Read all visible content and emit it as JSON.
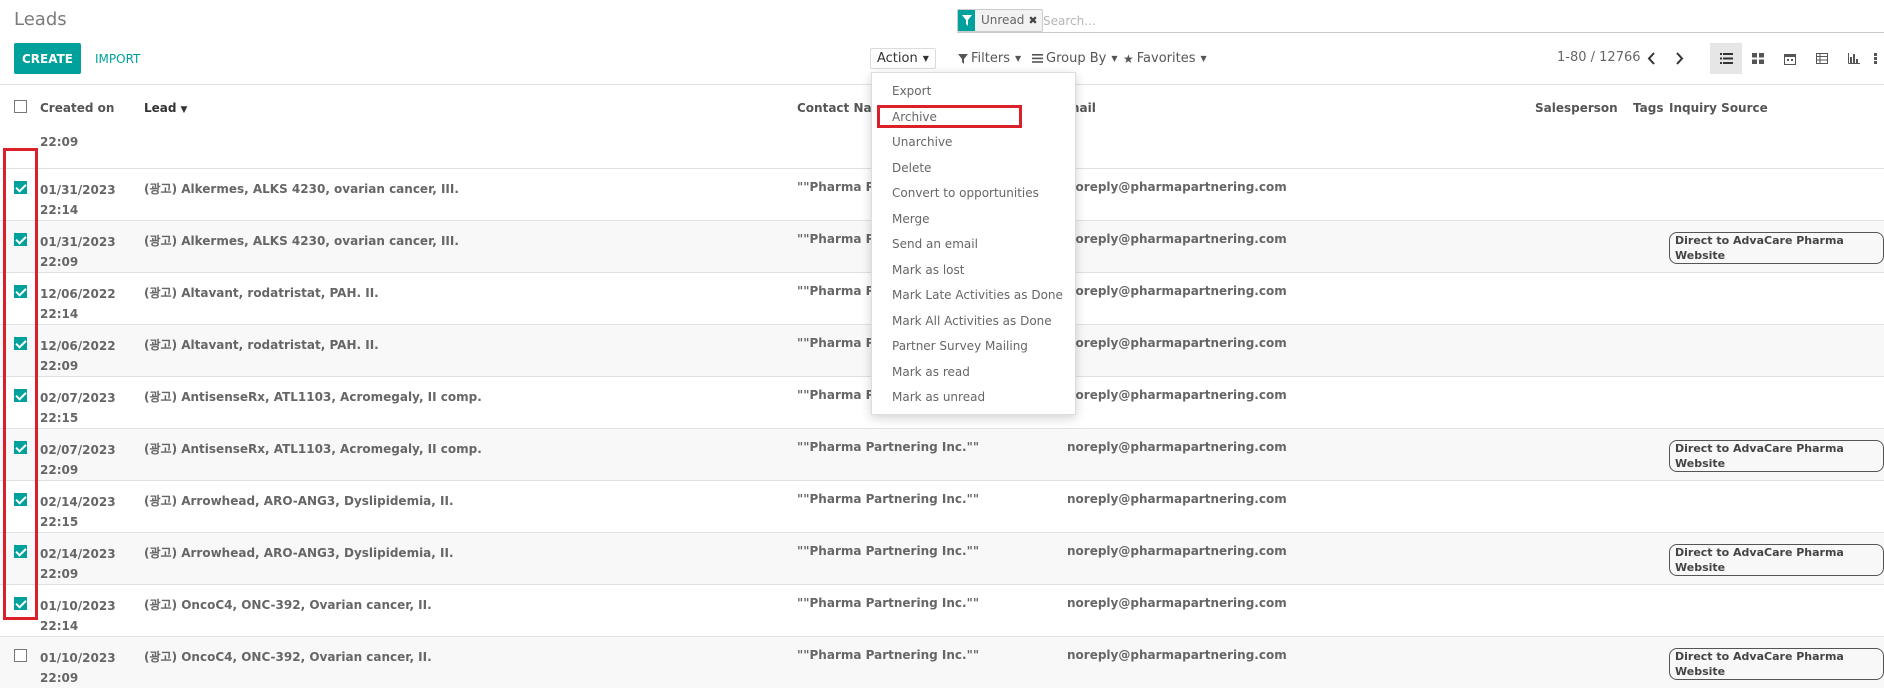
{
  "breadcrumb": "Leads",
  "search": {
    "facet_value": "Unread",
    "placeholder": "Search..."
  },
  "buttons": {
    "create": "CREATE",
    "import": "IMPORT",
    "action": "Action",
    "filters": "Filters",
    "group_by": "Group By",
    "favorites": "Favorites"
  },
  "pager": {
    "value": "1-80 / 12766"
  },
  "columns": {
    "created_on": "Created on",
    "lead": "Lead",
    "contact_name": "Contact Nam",
    "email": "mail",
    "salesperson": "Salesperson",
    "tags": "Tags",
    "inquiry_source": "Inquiry Source"
  },
  "first_row_time": "22:09",
  "rows": [
    {
      "date": "01/31/2023",
      "time": "22:14",
      "lead": "(광고) Alkermes, ALKS 4230, ovarian cancer, III.",
      "contact": "\"\"Pharma Pa",
      "email": "noreply@pharmapartnering.com",
      "source": ""
    },
    {
      "date": "01/31/2023",
      "time": "22:09",
      "lead": "(광고) Alkermes, ALKS 4230, ovarian cancer, III.",
      "contact": "\"\"Pharma Pa",
      "email": "noreply@pharmapartnering.com",
      "source": "Direct to AdvaCare Pharma Website"
    },
    {
      "date": "12/06/2022",
      "time": "22:14",
      "lead": "(광고) Altavant, rodatristat, PAH. II.",
      "contact": "\"\"Pharma Pa",
      "email": "noreply@pharmapartnering.com",
      "source": ""
    },
    {
      "date": "12/06/2022",
      "time": "22:09",
      "lead": "(광고) Altavant, rodatristat, PAH. II.",
      "contact": "\"\"Pharma Pa",
      "email": "noreply@pharmapartnering.com",
      "source": ""
    },
    {
      "date": "02/07/2023",
      "time": "22:15",
      "lead": "(광고) AntisenseRx, ATL1103, Acromegaly, II comp.",
      "contact": "\"\"Pharma Pa",
      "email": "noreply@pharmapartnering.com",
      "source": ""
    },
    {
      "date": "02/07/2023",
      "time": "22:09",
      "lead": "(광고) AntisenseRx, ATL1103, Acromegaly, II comp.",
      "contact": "\"\"Pharma Partnering Inc.\"\"",
      "email": "noreply@pharmapartnering.com",
      "source": "Direct to AdvaCare Pharma Website"
    },
    {
      "date": "02/14/2023",
      "time": "22:15",
      "lead": "(광고) Arrowhead, ARO-ANG3, Dyslipidemia, II.",
      "contact": "\"\"Pharma Partnering Inc.\"\"",
      "email": "noreply@pharmapartnering.com",
      "source": ""
    },
    {
      "date": "02/14/2023",
      "time": "22:09",
      "lead": "(광고) Arrowhead, ARO-ANG3, Dyslipidemia, II.",
      "contact": "\"\"Pharma Partnering Inc.\"\"",
      "email": "noreply@pharmapartnering.com",
      "source": "Direct to AdvaCare Pharma Website"
    },
    {
      "date": "01/10/2023",
      "time": "22:14",
      "lead": "(광고) OncoC4, ONC-392, Ovarian cancer, II.",
      "contact": "\"\"Pharma Partnering Inc.\"\"",
      "email": "noreply@pharmapartnering.com",
      "source": ""
    },
    {
      "date": "01/10/2023",
      "time": "22:09",
      "lead": "(광고) OncoC4, ONC-392, Ovarian cancer, II.",
      "contact": "\"\"Pharma Partnering Inc.\"\"",
      "email": "noreply@pharmapartnering.com",
      "source": "Direct to AdvaCare Pharma Website"
    }
  ],
  "action_menu": [
    "Export",
    "Archive",
    "Unarchive",
    "Delete",
    "Convert to opportunities",
    "Merge",
    "Send an email",
    "Mark as lost",
    "Mark Late Activities as Done",
    "Mark All Activities as Done",
    "Partner Survey Mailing",
    "Mark as read",
    "Mark as unread"
  ],
  "colors": {
    "accent": "#00a09d",
    "highlight": "#d9202b"
  }
}
